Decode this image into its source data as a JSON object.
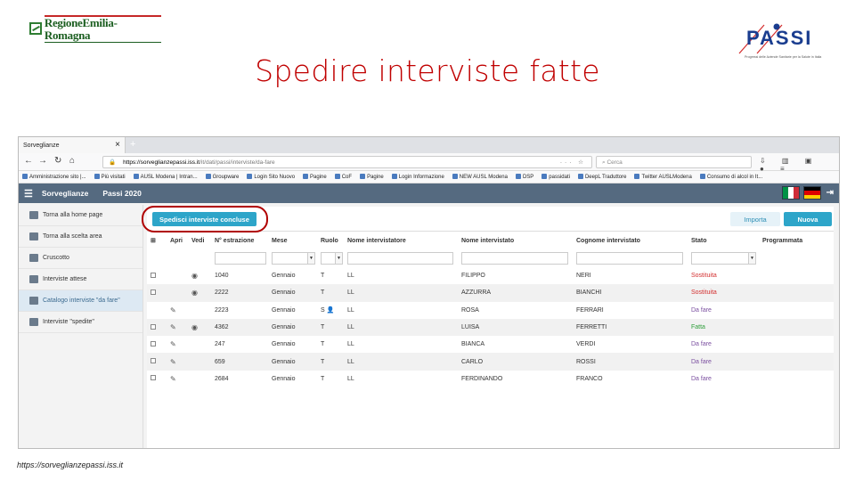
{
  "slide": {
    "logo_left": "RegioneEmilia-Romagna",
    "logo_right": "PASSI",
    "logo_right_tagline": "Progressi delle Aziende Sanitarie per la Salute in Italia",
    "title": "Spedire interviste fatte",
    "footer_url": "https://sorveglianzepassi.iss.it"
  },
  "browser": {
    "tab_title": "Sorveglianze",
    "url_host": "https://sorveglianzepassi.iss.it",
    "url_path": "/it/dati/passi/interviste/da-fare",
    "search_placeholder": "Cerca",
    "bookmarks": [
      "Amministrazione sito |...",
      "Più visitati",
      "AUSL Modena | Intran...",
      "Groupware",
      "Login Sito Nuovo",
      "Pagine",
      "CoF",
      "Pagine",
      "Login Informazione",
      "NEW AUSL Modena",
      "DSP",
      "passidati",
      "DeepL Traduttore",
      "Twitter AUSLModena",
      "Consumo di alcol in It..."
    ]
  },
  "app": {
    "title": "Sorveglianze",
    "subtitle": "Passi 2020",
    "flag_colors": {
      "it": [
        "#009246",
        "#ffffff",
        "#ce2b37"
      ],
      "de": [
        "#000000",
        "#dd0000",
        "#ffce00"
      ]
    }
  },
  "sidebar": {
    "items": [
      {
        "label": "Torna alla home page",
        "icon": "home-icon",
        "active": false
      },
      {
        "label": "Torna alla scelta area",
        "icon": "area-icon",
        "active": false
      },
      {
        "label": "Cruscotto",
        "icon": "dashboard-icon",
        "active": false
      },
      {
        "label": "Interviste attese",
        "icon": "list-icon",
        "active": false
      },
      {
        "label": "Catalogo interviste \"da fare\"",
        "icon": "clipboard-icon",
        "active": true
      },
      {
        "label": "Interviste \"spedite\"",
        "icon": "clipboard-check-icon",
        "active": false
      }
    ]
  },
  "toolbar": {
    "send_label": "Spedisci interviste concluse",
    "import_label": "Importa",
    "new_label": "Nuova"
  },
  "table": {
    "columns": [
      "",
      "Apri",
      "Vedi",
      "N° estrazione",
      "Mese",
      "Ruolo",
      "Nome intervistatore",
      "Nome intervistato",
      "Cognome intervistato",
      "Stato",
      "Programmata"
    ],
    "rows": [
      {
        "check": true,
        "open": false,
        "view": true,
        "num": "1040",
        "month": "Gennaio",
        "role": "T",
        "interviewer": "LL",
        "name": "FILIPPO",
        "surname": "NERI",
        "status": "Sostituita",
        "status_class": "st-sost"
      },
      {
        "check": true,
        "open": false,
        "view": true,
        "num": "2222",
        "month": "Gennaio",
        "role": "T",
        "interviewer": "LL",
        "name": "AZZURRA",
        "surname": "BIANCHI",
        "status": "Sostituita",
        "status_class": "st-sost"
      },
      {
        "check": false,
        "open": true,
        "view": false,
        "num": "2223",
        "month": "Gennaio",
        "role": "S",
        "interviewer": "LL",
        "name": "ROSA",
        "surname": "FERRARI",
        "status": "Da fare",
        "status_class": "st-dafare"
      },
      {
        "check": true,
        "open": true,
        "view": true,
        "num": "4362",
        "month": "Gennaio",
        "role": "T",
        "interviewer": "LL",
        "name": "LUISA",
        "surname": "FERRETTI",
        "status": "Fatta",
        "status_class": "st-fatta"
      },
      {
        "check": true,
        "open": true,
        "view": false,
        "num": "247",
        "month": "Gennaio",
        "role": "T",
        "interviewer": "LL",
        "name": "BIANCA",
        "surname": "VERDI",
        "status": "Da fare",
        "status_class": "st-dafare"
      },
      {
        "check": true,
        "open": true,
        "view": false,
        "num": "659",
        "month": "Gennaio",
        "role": "T",
        "interviewer": "LL",
        "name": "CARLO",
        "surname": "ROSSI",
        "status": "Da fare",
        "status_class": "st-dafare"
      },
      {
        "check": true,
        "open": true,
        "view": false,
        "num": "2684",
        "month": "Gennaio",
        "role": "T",
        "interviewer": "LL",
        "name": "FERDINANDO",
        "surname": "FRANCO",
        "status": "Da fare",
        "status_class": "st-dafare"
      }
    ]
  }
}
